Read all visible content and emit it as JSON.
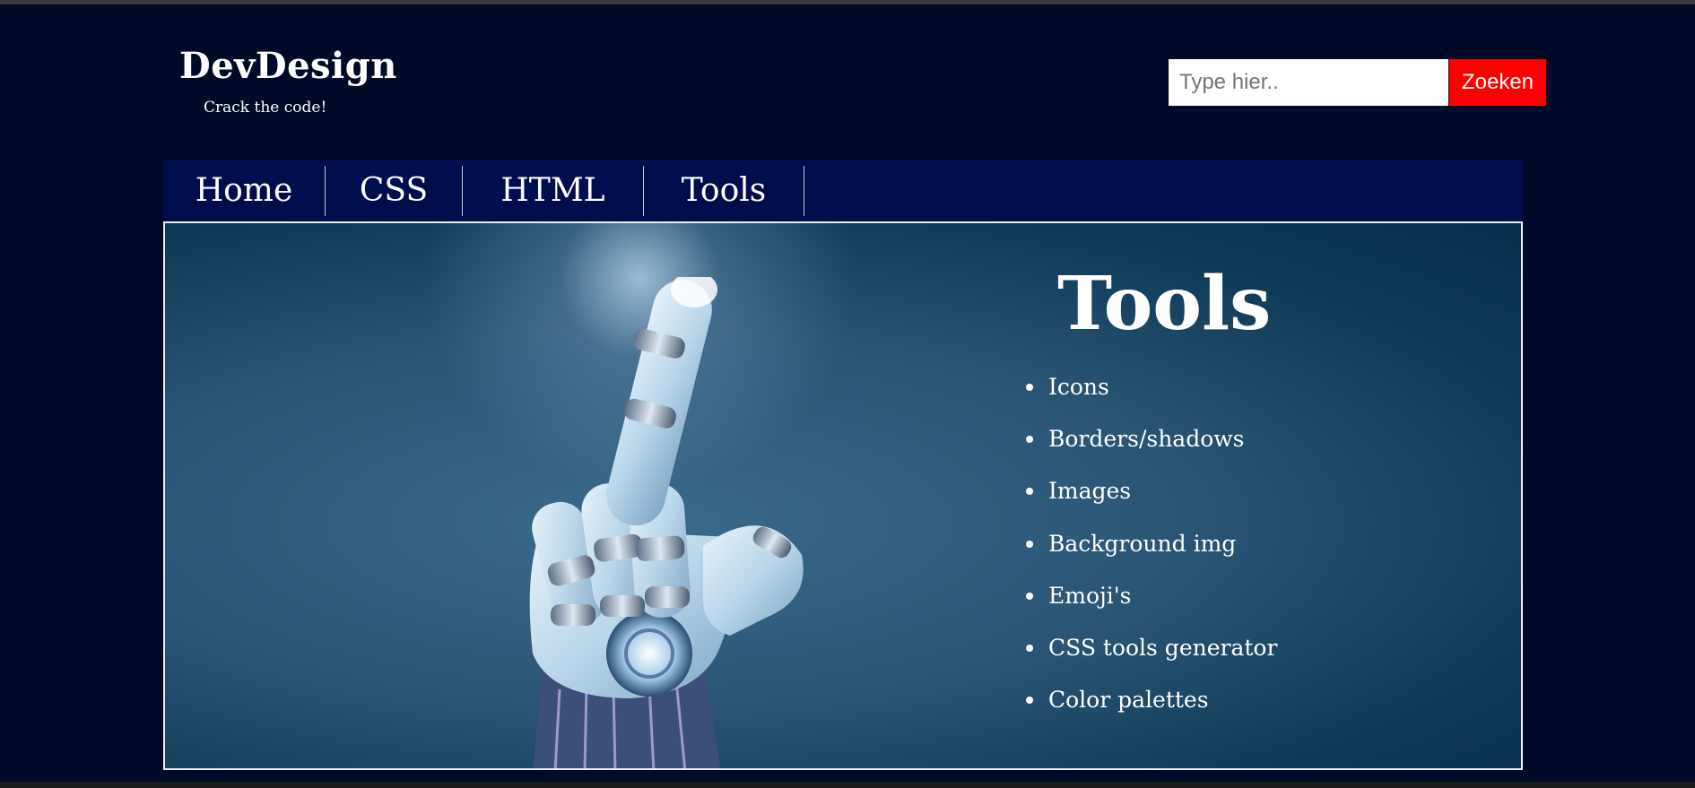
{
  "site": {
    "logo": "DevDesign",
    "tagline": "Crack the code!"
  },
  "search": {
    "placeholder": "Type hier..",
    "button_label": "Zoeken"
  },
  "nav": {
    "items": [
      {
        "label": "Home"
      },
      {
        "label": "CSS"
      },
      {
        "label": "HTML"
      },
      {
        "label": "Tools"
      }
    ]
  },
  "hero": {
    "title": "Tools",
    "image": "robot-hand-pointing",
    "tools": [
      "Icons",
      "Borders/shadows",
      "Images",
      "Background img",
      "Emoji's",
      "CSS tools generator",
      "Color palettes"
    ]
  },
  "colors": {
    "page_background": "#000a28",
    "nav_background": "#000e4e",
    "search_button": "#ff0000",
    "hero_background": "#2a5474",
    "text": "#ffffff"
  }
}
